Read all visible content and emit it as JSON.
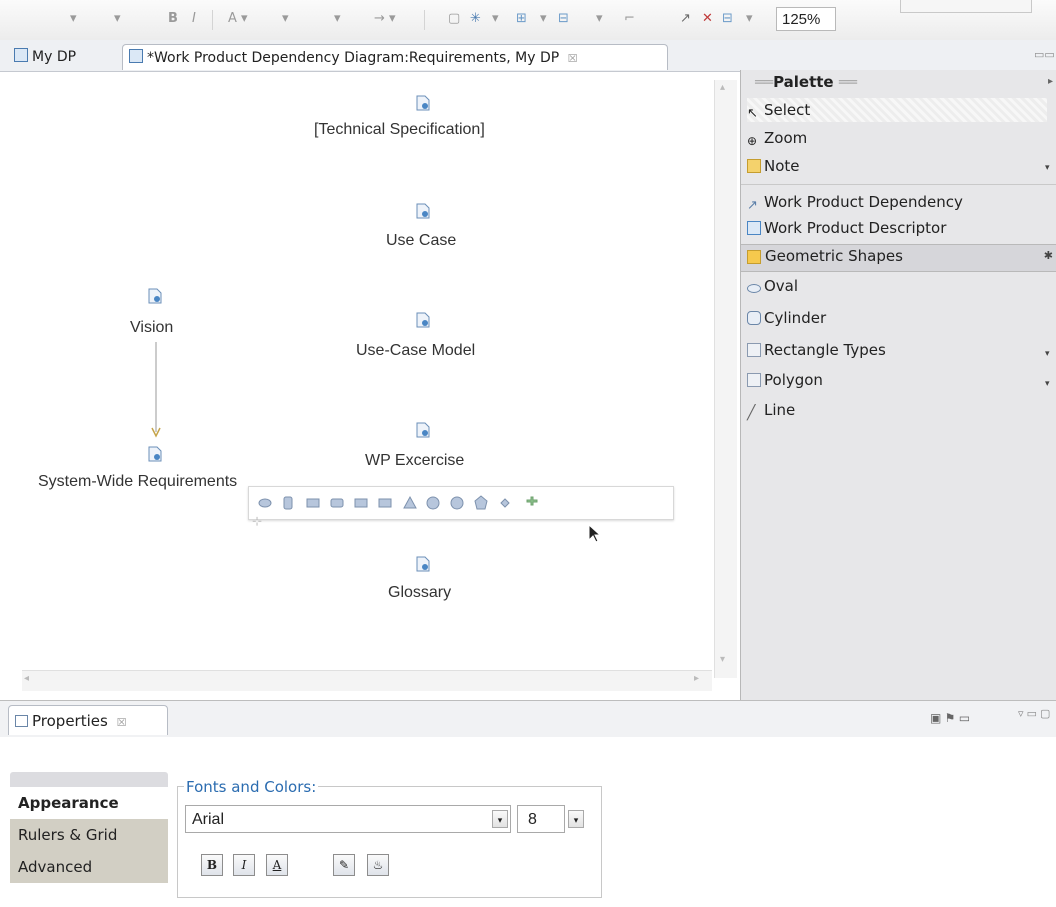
{
  "toolbar": {
    "zoom": "125%",
    "glyphs": [
      "▾",
      "▾",
      "B",
      "I",
      "A ▾",
      "▾",
      "▾",
      "→ ▾",
      "▾",
      "▾",
      "▾",
      "▾",
      "✕",
      "▾"
    ]
  },
  "editor_tabs": [
    {
      "label": "My DP"
    },
    {
      "label": "*Work Product Dependency Diagram:Requirements, My DP",
      "close": "☒"
    }
  ],
  "diagram": {
    "nodes": [
      {
        "label": "[Technical Specification]"
      },
      {
        "label": "Use Case"
      },
      {
        "label": "Vision"
      },
      {
        "label": "Use-Case Model"
      },
      {
        "label": "System-Wide Requirements"
      },
      {
        "label": "WP Excercise"
      },
      {
        "label": "Glossary"
      }
    ]
  },
  "palette": {
    "title": "Palette",
    "items": [
      {
        "label": "Select",
        "icon": "cursor-icon"
      },
      {
        "label": "Zoom",
        "icon": "zoom-icon"
      },
      {
        "label": "Note",
        "icon": "note-icon"
      },
      {
        "label": "Work Product Dependency",
        "icon": "dependency-icon"
      },
      {
        "label": "Work Product Descriptor",
        "icon": "descriptor-icon"
      }
    ],
    "drawer_label": "Geometric Shapes",
    "shapes": [
      {
        "label": "Oval",
        "icon": "oval-icon"
      },
      {
        "label": "Cylinder",
        "icon": "cylinder-icon"
      },
      {
        "label": "Rectangle Types",
        "icon": "rectangle-icon"
      },
      {
        "label": "Polygon",
        "icon": "polygon-icon"
      },
      {
        "label": "Line",
        "icon": "line-icon"
      }
    ]
  },
  "properties": {
    "tab_label": "Properties",
    "close": "☒",
    "sections": [
      {
        "label": "Appearance"
      },
      {
        "label": "Rulers & Grid"
      },
      {
        "label": "Advanced"
      }
    ],
    "group_label": "Fonts and Colors:",
    "font_name": "Arial",
    "font_size": "8",
    "format_buttons": [
      {
        "glyph": "B",
        "icon": "bold-icon"
      },
      {
        "glyph": "I",
        "icon": "italic-icon"
      },
      {
        "glyph": "A",
        "icon": "font-color-icon"
      },
      {
        "glyph": "✎",
        "icon": "line-color-icon"
      },
      {
        "glyph": "♨",
        "icon": "fill-color-icon"
      }
    ]
  },
  "colors": {
    "link": "#2b6cb0",
    "palette_bg": "#e7e7e9",
    "selected_tab": "#ffffff"
  }
}
